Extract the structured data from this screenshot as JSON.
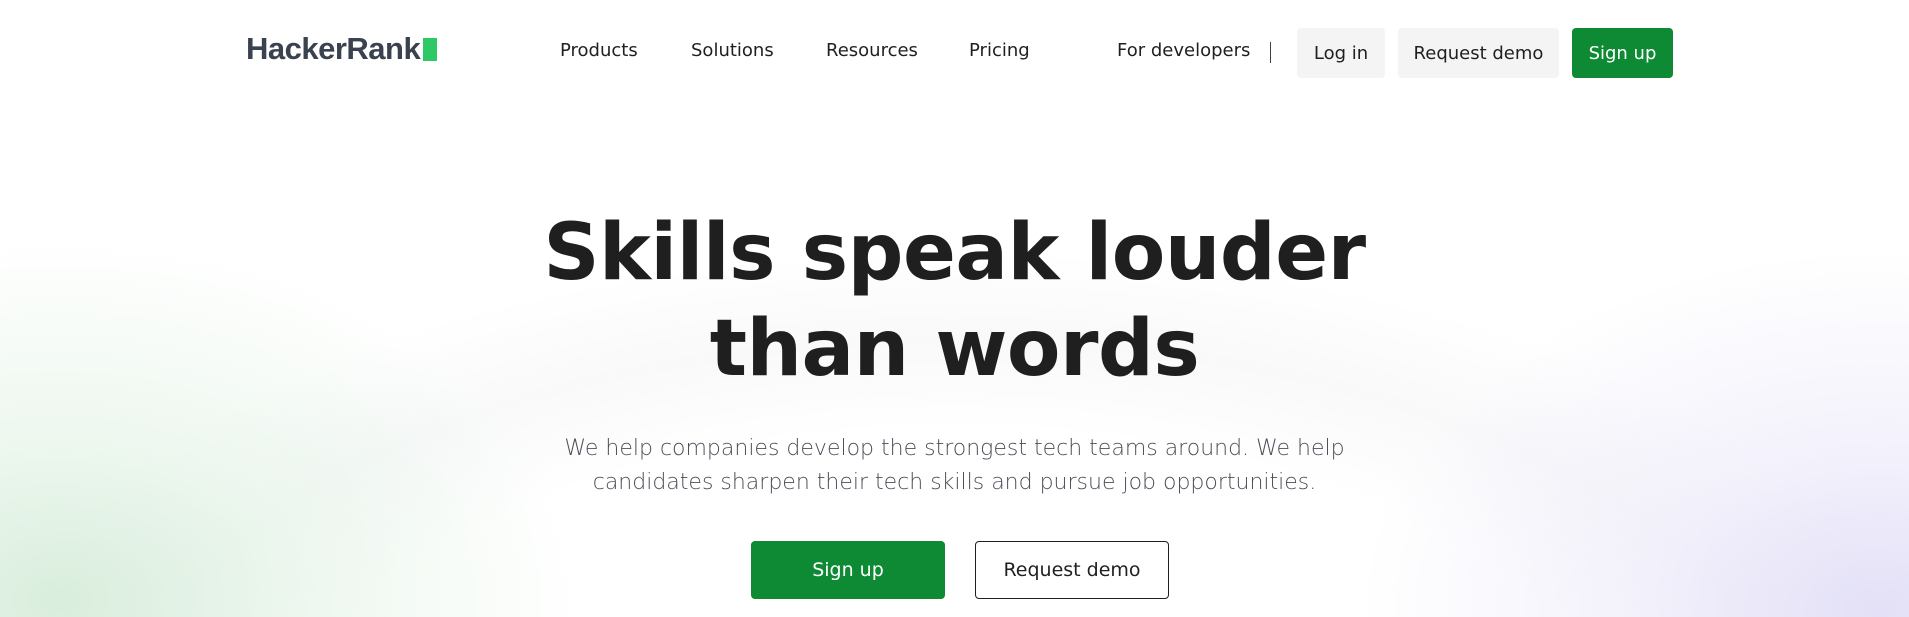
{
  "nav": {
    "logo_text": "HackerRank",
    "menu": [
      "Products",
      "Solutions",
      "Resources",
      "Pricing"
    ],
    "for_developers": "For developers",
    "login": "Log in",
    "request_demo": "Request demo",
    "signup": "Sign up"
  },
  "hero": {
    "title_line1": "Skills speak louder",
    "title_line2": "than words",
    "subtitle_line1": "We help companies develop the strongest tech teams around. We help",
    "subtitle_line2": "candidates sharpen their tech skills and pursue job opportunities.",
    "cta_primary": "Sign up",
    "cta_secondary": "Request demo"
  },
  "colors": {
    "brand_green": "#0e8a34",
    "logo_green": "#2ec866",
    "logo_text": "#39424e"
  }
}
